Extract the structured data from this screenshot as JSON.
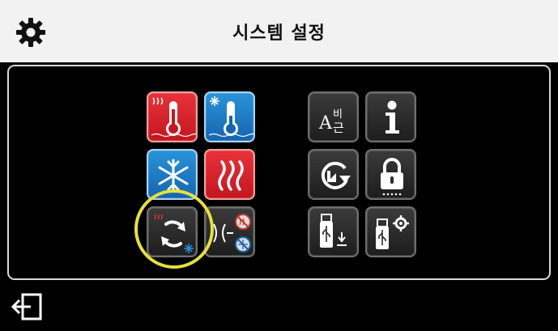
{
  "header": {
    "title": "시스템 설정",
    "settings_icon": "gear-icon"
  },
  "tiles": [
    {
      "name": "heating-temperature",
      "icon": "thermometer-heat-icon",
      "color": "#d7262d"
    },
    {
      "name": "cooling-temperature",
      "icon": "thermometer-snow-icon",
      "color": "#1f7dc6"
    },
    {
      "name": "cooling-mode",
      "icon": "snowflake-icon",
      "color": "#1f7dc6"
    },
    {
      "name": "heating-mode",
      "icon": "heat-waves-icon",
      "color": "#d7262d"
    },
    {
      "name": "auto-changeover",
      "icon": "heat-cool-changeover-icon",
      "color": "#2b2b2b",
      "highlighted": true
    },
    {
      "name": "heat-cool-separation",
      "icon": "heat-cool-disable-icon",
      "color": "#2b2b2b"
    },
    {
      "name": "language",
      "icon": "language-icon",
      "color": "#2b2b2b",
      "glyph": "A비\n근"
    },
    {
      "name": "information",
      "icon": "info-icon",
      "color": "#2b2b2b",
      "glyph": "i"
    },
    {
      "name": "reset",
      "icon": "factory-reset-icon",
      "color": "#2b2b2b"
    },
    {
      "name": "lock",
      "icon": "lock-icon",
      "color": "#2b2b2b"
    },
    {
      "name": "usb-download",
      "icon": "usb-download-icon",
      "color": "#2b2b2b"
    },
    {
      "name": "usb-settings",
      "icon": "usb-settings-icon",
      "color": "#2b2b2b"
    }
  ],
  "footer": {
    "exit_icon": "exit-icon"
  },
  "colors": {
    "highlight_ring": "#e6e03c",
    "header_bg": "#f2f2f2",
    "panel_border": "#d9d9d9"
  }
}
